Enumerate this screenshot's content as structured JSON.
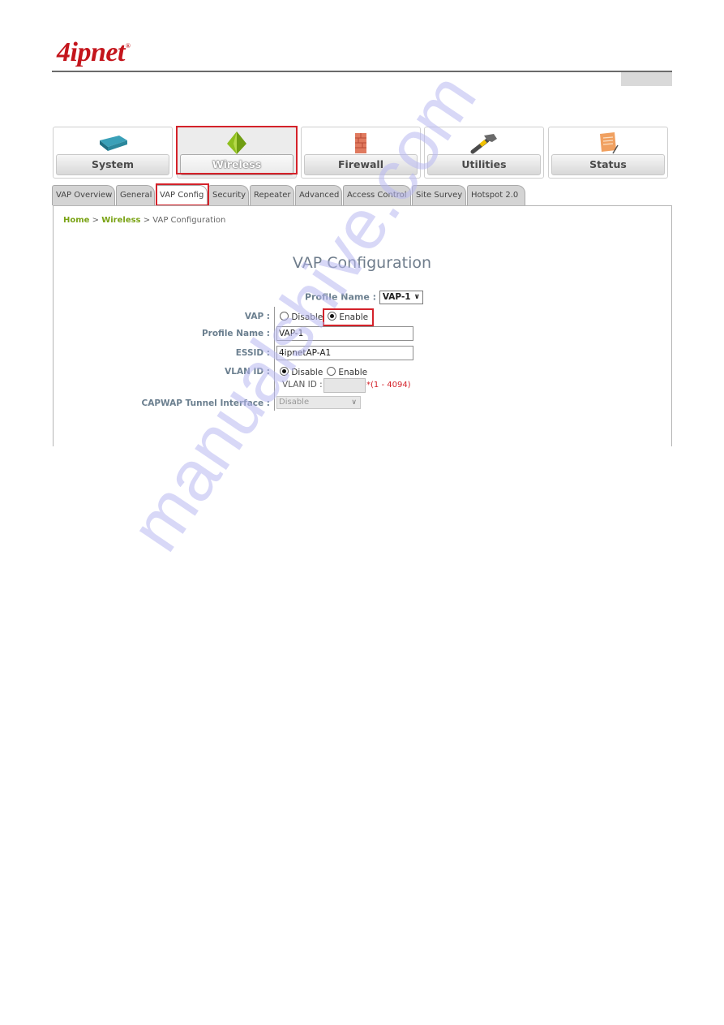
{
  "brand": {
    "logo_text": "4ipnet",
    "registered": "®",
    "logo_color": "#c4151c"
  },
  "nav_tiles": [
    {
      "label": "System",
      "icon": "router-icon",
      "active": false
    },
    {
      "label": "Wireless",
      "icon": "pyramid-icon",
      "active": true
    },
    {
      "label": "Firewall",
      "icon": "brick-wall-icon",
      "active": false
    },
    {
      "label": "Utilities",
      "icon": "hammer-icon",
      "active": false
    },
    {
      "label": "Status",
      "icon": "notepad-icon",
      "active": false
    }
  ],
  "tabs": [
    {
      "label": "VAP Overview",
      "active": false
    },
    {
      "label": "General",
      "active": false
    },
    {
      "label": "VAP Config",
      "active": true
    },
    {
      "label": "Security",
      "active": false
    },
    {
      "label": "Repeater",
      "active": false
    },
    {
      "label": "Advanced",
      "active": false
    },
    {
      "label": "Access Control",
      "active": false
    },
    {
      "label": "Site Survey",
      "active": false
    },
    {
      "label": "Hotspot 2.0",
      "active": false
    }
  ],
  "breadcrumb": {
    "home": "Home",
    "sep": ">",
    "section": "Wireless",
    "current": "VAP Configuration"
  },
  "page_title": "VAP Configuration",
  "profile_selector": {
    "label": "Profile Name :",
    "value": "VAP-1"
  },
  "form": {
    "vap": {
      "label": "VAP :",
      "options": [
        "Disable",
        "Enable"
      ],
      "selected": "Enable"
    },
    "profile_name": {
      "label": "Profile Name :",
      "value": "VAP-1"
    },
    "essid": {
      "label": "ESSID :",
      "value": "4ipnetAP-A1"
    },
    "vlan": {
      "label": "VLAN ID :",
      "options": [
        "Disable",
        "Enable"
      ],
      "selected": "Disable",
      "sub_label": "VLAN ID :",
      "value": "",
      "range": "*(1 - 4094)"
    },
    "capwap": {
      "label": "CAPWAP Tunnel Interface :",
      "value": "Disable"
    }
  },
  "highlight_color": "#d4222a",
  "watermark": "manualshive.com"
}
